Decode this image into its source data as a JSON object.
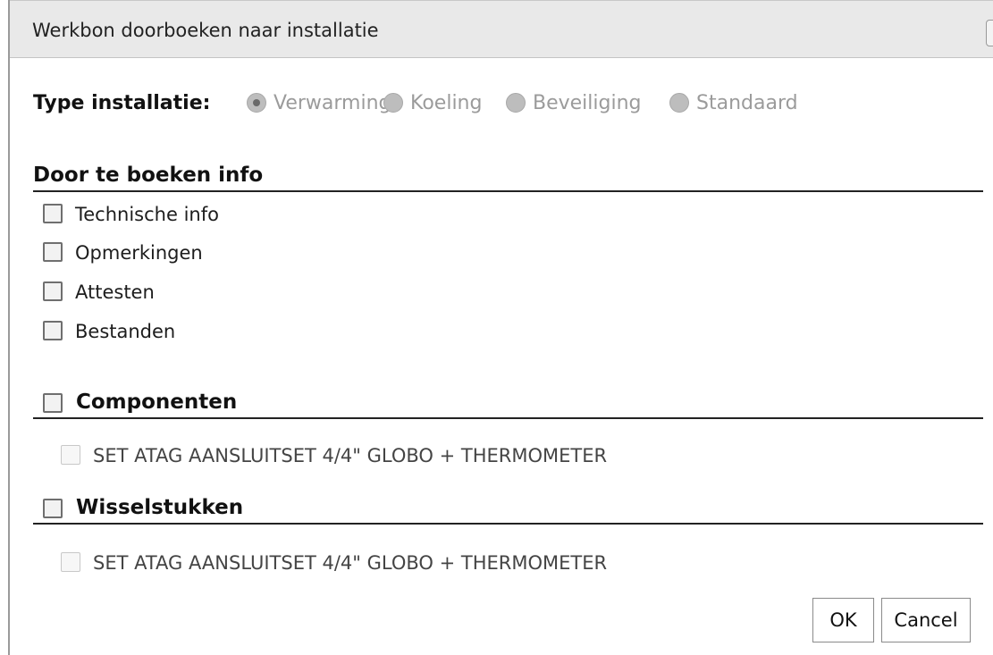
{
  "dialog": {
    "title": "Werkbon doorboeken naar installatie",
    "close_glyph": "×"
  },
  "type_installatie": {
    "label": "Type installatie:",
    "options": [
      {
        "label": "Verwarming",
        "selected": true
      },
      {
        "label": "Koeling",
        "selected": false
      },
      {
        "label": "Beveiliging",
        "selected": false
      },
      {
        "label": "Standaard",
        "selected": false
      }
    ]
  },
  "door_te_boeken": {
    "heading": "Door te boeken info",
    "items": [
      {
        "label": "Technische info",
        "checked": false
      },
      {
        "label": "Opmerkingen",
        "checked": false
      },
      {
        "label": "Attesten",
        "checked": false
      },
      {
        "label": "Bestanden",
        "checked": false
      }
    ]
  },
  "componenten": {
    "heading": "Componenten",
    "checked": false,
    "items": [
      {
        "label": "SET ATAG AANSLUITSET 4/4\" GLOBO + THERMOMETER",
        "checked": false,
        "disabled": true
      }
    ]
  },
  "wisselstukken": {
    "heading": "Wisselstukken",
    "checked": false,
    "items": [
      {
        "label": "SET ATAG AANSLUITSET 4/4\" GLOBO + THERMOMETER",
        "checked": false,
        "disabled": true
      }
    ]
  },
  "buttons": {
    "ok": "OK",
    "cancel": "Cancel"
  }
}
